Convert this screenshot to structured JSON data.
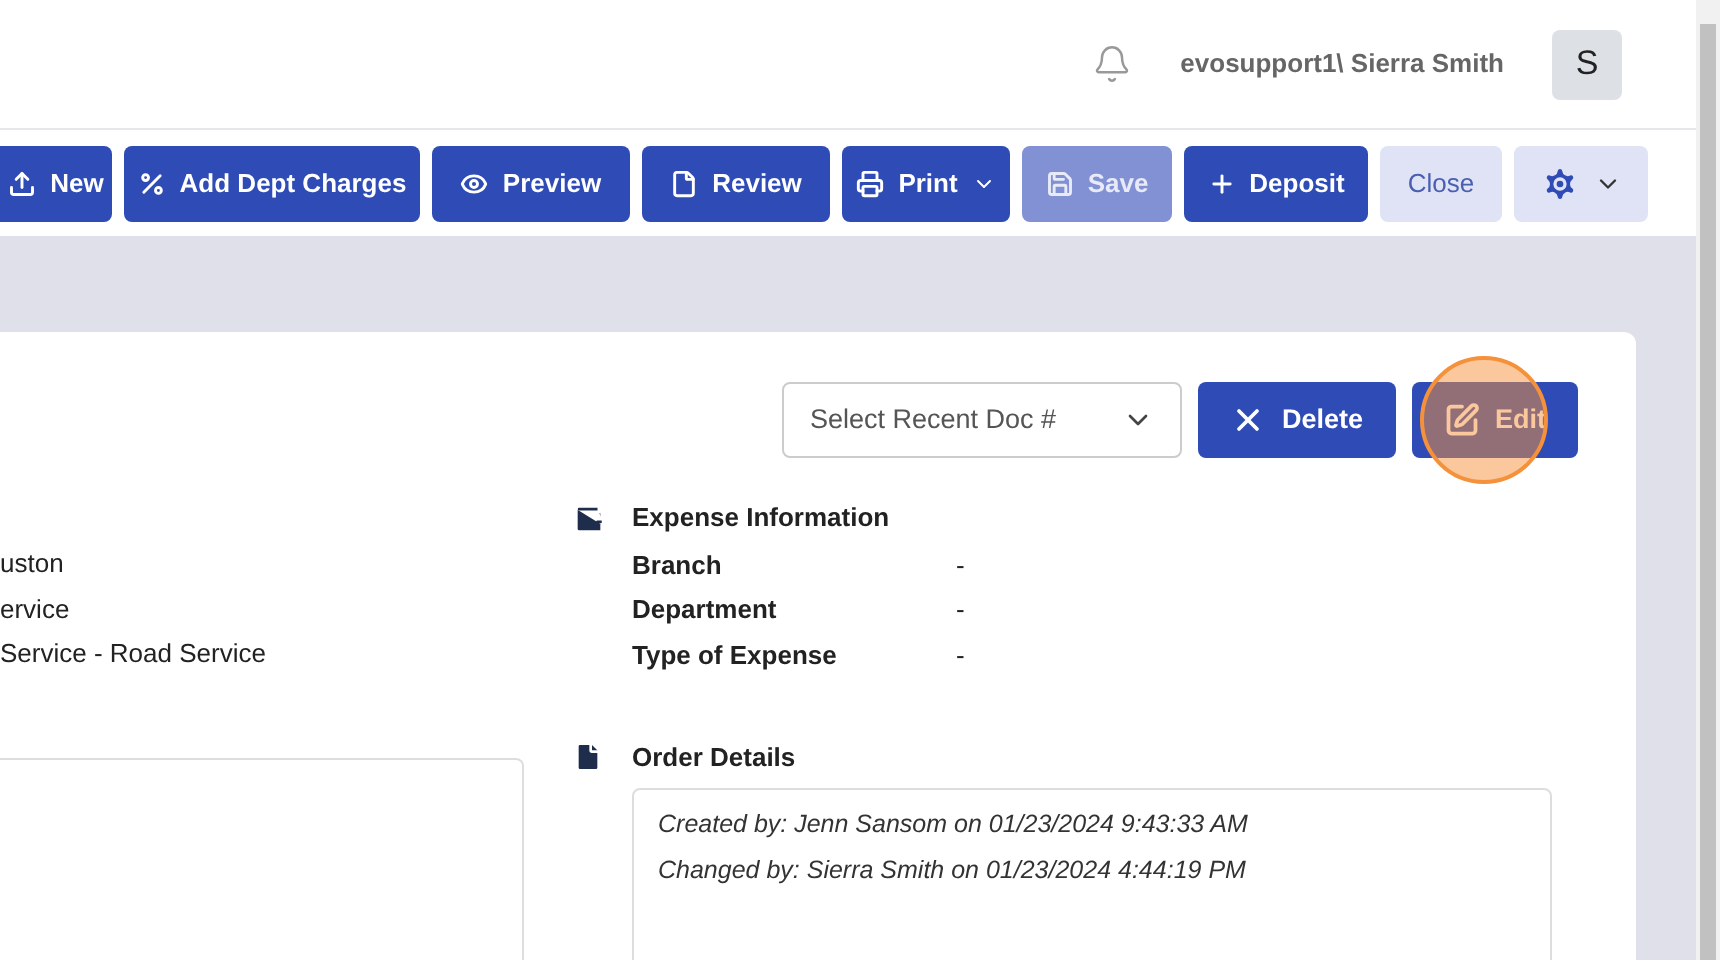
{
  "header": {
    "user": "evosupport1\\ Sierra Smith",
    "avatar": "S"
  },
  "toolbar": [
    {
      "kind": "primary",
      "label": "New"
    },
    {
      "kind": "primary",
      "label": "Add Dept Charges"
    },
    {
      "kind": "primary",
      "label": "Preview"
    },
    {
      "kind": "primary",
      "label": "Review"
    },
    {
      "kind": "dropdown",
      "label": "Print"
    },
    {
      "kind": "disabled",
      "label": "Save"
    },
    {
      "kind": "primary",
      "label": "Deposit"
    },
    {
      "kind": "light",
      "label": "Close"
    },
    {
      "kind": "settings"
    }
  ],
  "recent_doc_select": {
    "placeholder": "Select Recent Doc #"
  },
  "actions": [
    {
      "label": "Delete",
      "highlighted": false
    },
    {
      "label": "Edit",
      "highlighted": true
    }
  ],
  "left_fields": [
    "uston",
    "ervice",
    "Service - Road Service"
  ],
  "expense_information": {
    "title": "Expense Information",
    "rows": [
      {
        "label": "Branch",
        "value": "-"
      },
      {
        "label": "Department",
        "value": "-"
      },
      {
        "label": "Type of Expense",
        "value": "-"
      }
    ]
  },
  "order_details": {
    "title": "Order Details",
    "lines": [
      "Created by: Jenn Sansom on 01/23/2024 9:43:33 AM",
      "Changed by: Sierra Smith on 01/23/2024 4:44:19 PM"
    ]
  }
}
